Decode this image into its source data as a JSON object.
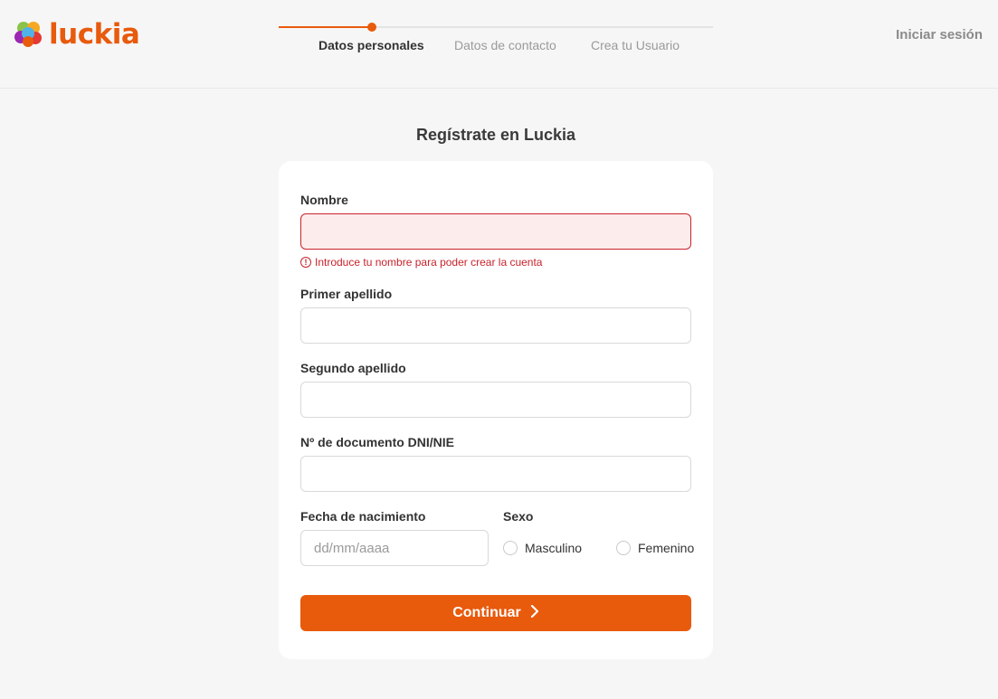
{
  "brand": {
    "name": "luckia",
    "accent": "#e85a0c"
  },
  "steps": {
    "items": [
      {
        "label": "Datos personales",
        "active": true
      },
      {
        "label": "Datos de contacto",
        "active": false
      },
      {
        "label": "Crea tu Usuario",
        "active": false
      }
    ],
    "current": 1,
    "total": 3
  },
  "header": {
    "login_label": "Iniciar sesión"
  },
  "form": {
    "title": "Regístrate en Luckia",
    "nombre": {
      "label": "Nombre",
      "value": "",
      "error": "Introduce tu nombre para poder crear la cuenta"
    },
    "primer_apellido": {
      "label": "Primer apellido",
      "value": ""
    },
    "segundo_apellido": {
      "label": "Segundo apellido",
      "value": ""
    },
    "documento": {
      "label": "Nº de documento DNI/NIE",
      "value": ""
    },
    "fecha": {
      "label": "Fecha de nacimiento",
      "placeholder": "dd/mm/aaaa",
      "value": ""
    },
    "sexo": {
      "label": "Sexo",
      "options": [
        "Masculino",
        "Femenino"
      ],
      "selected": null
    },
    "submit_label": "Continuar"
  },
  "colors": {
    "error": "#c8232c",
    "error_bg": "#fdecec",
    "accent": "#e85a0c",
    "background": "#f6f6f6"
  },
  "icons": [
    "luckia-logo-icon",
    "error-circle-icon",
    "chevron-right-icon"
  ]
}
